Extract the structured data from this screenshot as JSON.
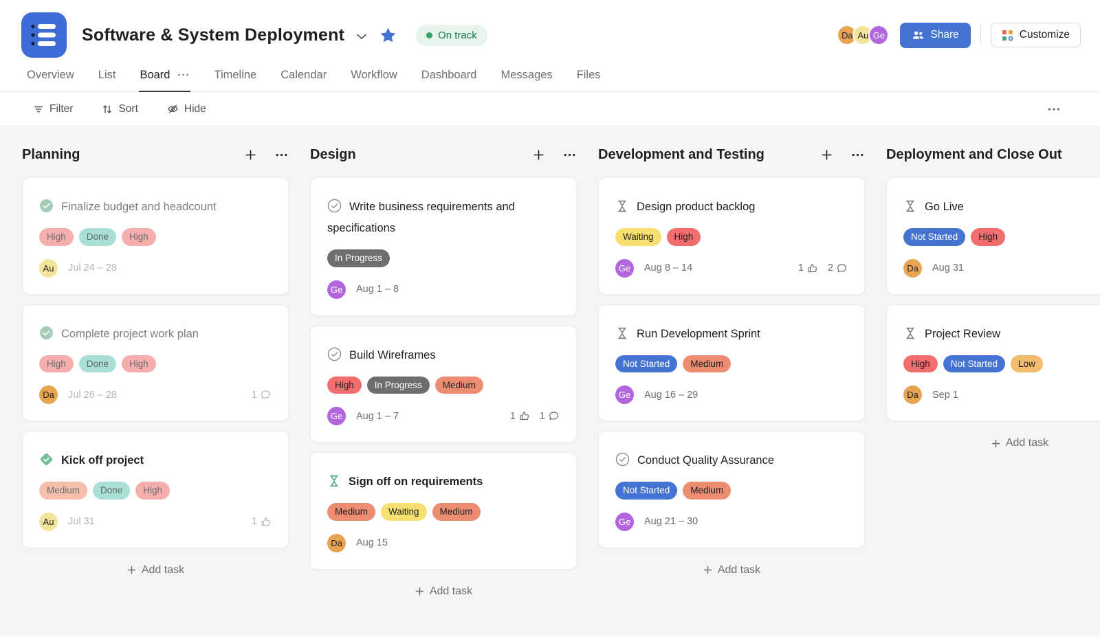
{
  "header": {
    "title": "Software & System Deployment",
    "status_badge": "On track",
    "share_label": "Share",
    "customize_label": "Customize",
    "avatars": [
      {
        "initials": "Da",
        "bg": "#e7a452",
        "fg": "#1e1f21"
      },
      {
        "initials": "Au",
        "bg": "#f3e49b",
        "fg": "#1e1f21"
      },
      {
        "initials": "Ge",
        "bg": "#b266dd",
        "fg": "#ffffff"
      }
    ]
  },
  "tabs": [
    {
      "label": "Overview",
      "active": false
    },
    {
      "label": "List",
      "active": false
    },
    {
      "label": "Board",
      "active": true,
      "overflow": true
    },
    {
      "label": "Timeline",
      "active": false
    },
    {
      "label": "Calendar",
      "active": false
    },
    {
      "label": "Workflow",
      "active": false
    },
    {
      "label": "Dashboard",
      "active": false
    },
    {
      "label": "Messages",
      "active": false
    },
    {
      "label": "Files",
      "active": false
    }
  ],
  "toolbar": {
    "filter_label": "Filter",
    "sort_label": "Sort",
    "hide_label": "Hide"
  },
  "palette": {
    "accent_blue": "#4573d2",
    "status_green": "#35a065",
    "board_bg": "#f6f5f3",
    "tags": {
      "high": {
        "bg": "#f26d6d",
        "fg": "#1e1f21"
      },
      "high-faded": {
        "bg": "#f6adad",
        "fg": "#6d6e6f"
      },
      "medium": {
        "bg": "#ec8d71",
        "fg": "#1e1f21"
      },
      "medium-faded": {
        "bg": "#f4bfab",
        "fg": "#6d6e6f"
      },
      "low": {
        "bg": "#f1bd6c",
        "fg": "#1e1f21"
      },
      "waiting": {
        "bg": "#f8df72",
        "fg": "#1e1f21"
      },
      "done-faded": {
        "bg": "#a9dfd4",
        "fg": "#5f6b69"
      },
      "in-progress": {
        "bg": "#6d6e6f",
        "fg": "#ffffff"
      },
      "not-started": {
        "bg": "#4573d2",
        "fg": "#ffffff"
      }
    },
    "icons": {
      "check-complete": "#a3cbb5",
      "milestone-complete": "#76bc9b",
      "check-incomplete": "#8a8d8f",
      "approval": "#77787a",
      "approval-green": "#42a284"
    },
    "avatars": {
      "Da": {
        "bg": "#e7a452",
        "fg": "#1e1f21"
      },
      "Au": {
        "bg": "#f3e49b",
        "fg": "#1e1f21"
      },
      "Ge": {
        "bg": "#b266dd",
        "fg": "#ffffff"
      }
    }
  },
  "board": {
    "add_task_label": "Add task",
    "columns": [
      {
        "title": "Planning",
        "cards": [
          {
            "title": "Finalize budget and headcount",
            "icon": "check-complete",
            "bold": false,
            "muted_title": true,
            "muted_meta": true,
            "tags": [
              {
                "label": "High",
                "style": "high-faded"
              },
              {
                "label": "Done",
                "style": "done-faded"
              },
              {
                "label": "High",
                "style": "high-faded"
              }
            ],
            "avatar": "Au",
            "date": "Jul 24 – 28",
            "likes": null,
            "comments": null
          },
          {
            "title": "Complete project work plan",
            "icon": "check-complete",
            "bold": false,
            "muted_title": true,
            "muted_meta": true,
            "tags": [
              {
                "label": "High",
                "style": "high-faded"
              },
              {
                "label": "Done",
                "style": "done-faded"
              },
              {
                "label": "High",
                "style": "high-faded"
              }
            ],
            "avatar": "Da",
            "date": "Jul 26 – 28",
            "likes": null,
            "comments": "1"
          },
          {
            "title": "Kick off project",
            "icon": "milestone-complete",
            "bold": true,
            "muted_title": false,
            "muted_meta": true,
            "tags": [
              {
                "label": "Medium",
                "style": "medium-faded"
              },
              {
                "label": "Done",
                "style": "done-faded"
              },
              {
                "label": "High",
                "style": "high-faded"
              }
            ],
            "avatar": "Au",
            "date": "Jul 31",
            "likes": "1",
            "comments": null
          }
        ]
      },
      {
        "title": "Design",
        "cards": [
          {
            "title": "Write business requirements and specifications",
            "icon": "check-incomplete",
            "bold": false,
            "muted_title": false,
            "muted_meta": false,
            "tags": [
              {
                "label": "In Progress",
                "style": "in-progress"
              }
            ],
            "avatar": "Ge",
            "date": "Aug 1 – 8",
            "likes": null,
            "comments": null
          },
          {
            "title": "Build Wireframes",
            "icon": "check-incomplete",
            "bold": false,
            "muted_title": false,
            "muted_meta": false,
            "tags": [
              {
                "label": "High",
                "style": "high"
              },
              {
                "label": "In Progress",
                "style": "in-progress"
              },
              {
                "label": "Medium",
                "style": "medium"
              }
            ],
            "avatar": "Ge",
            "date": "Aug 1 – 7",
            "likes": "1",
            "comments": "1"
          },
          {
            "title": "Sign off on requirements",
            "icon": "approval-green",
            "bold": true,
            "muted_title": false,
            "muted_meta": false,
            "tags": [
              {
                "label": "Medium",
                "style": "medium"
              },
              {
                "label": "Waiting",
                "style": "waiting"
              },
              {
                "label": "Medium",
                "style": "medium"
              }
            ],
            "avatar": "Da",
            "date": "Aug 15",
            "likes": null,
            "comments": null
          }
        ]
      },
      {
        "title": "Development and Testing",
        "cards": [
          {
            "title": "Design product backlog",
            "icon": "approval",
            "bold": false,
            "muted_title": false,
            "muted_meta": false,
            "tags": [
              {
                "label": "Waiting",
                "style": "waiting"
              },
              {
                "label": "High",
                "style": "high"
              }
            ],
            "avatar": "Ge",
            "date": "Aug 8 – 14",
            "likes": "1",
            "comments": "2"
          },
          {
            "title": "Run Development Sprint",
            "icon": "approval",
            "bold": false,
            "muted_title": false,
            "muted_meta": false,
            "tags": [
              {
                "label": "Not Started",
                "style": "not-started"
              },
              {
                "label": "Medium",
                "style": "medium"
              }
            ],
            "avatar": "Ge",
            "date": "Aug 16 – 29",
            "likes": null,
            "comments": null
          },
          {
            "title": "Conduct Quality Assurance",
            "icon": "check-incomplete",
            "bold": false,
            "muted_title": false,
            "muted_meta": false,
            "tags": [
              {
                "label": "Not Started",
                "style": "not-started"
              },
              {
                "label": "Medium",
                "style": "medium"
              }
            ],
            "avatar": "Ge",
            "date": "Aug 21 – 30",
            "likes": null,
            "comments": null
          }
        ]
      },
      {
        "title": "Deployment and Close Out",
        "cards": [
          {
            "title": "Go Live",
            "icon": "approval",
            "bold": false,
            "muted_title": false,
            "muted_meta": false,
            "tags": [
              {
                "label": "Not Started",
                "style": "not-started"
              },
              {
                "label": "High",
                "style": "high"
              }
            ],
            "avatar": "Da",
            "date": "Aug 31",
            "likes": null,
            "comments": null
          },
          {
            "title": "Project Review",
            "icon": "approval",
            "bold": false,
            "muted_title": false,
            "muted_meta": false,
            "tags": [
              {
                "label": "High",
                "style": "high"
              },
              {
                "label": "Not Started",
                "style": "not-started"
              },
              {
                "label": "Low",
                "style": "low"
              }
            ],
            "avatar": "Da",
            "date": "Sep 1",
            "likes": null,
            "comments": null
          }
        ]
      }
    ]
  }
}
